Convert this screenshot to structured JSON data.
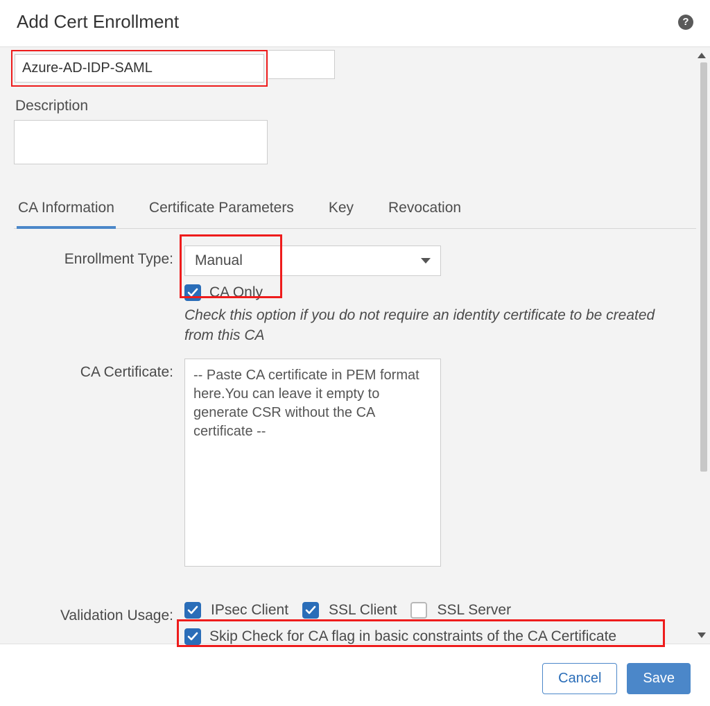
{
  "dialog": {
    "title": "Add Cert Enrollment",
    "help_tooltip": "?"
  },
  "form": {
    "name_value": "Azure-AD-IDP-SAML",
    "description_label": "Description",
    "description_value": ""
  },
  "tabs": [
    {
      "label": "CA Information",
      "active": true
    },
    {
      "label": "Certificate Parameters",
      "active": false
    },
    {
      "label": "Key",
      "active": false
    },
    {
      "label": "Revocation",
      "active": false
    }
  ],
  "ca_info": {
    "enrollment_type_label": "Enrollment Type:",
    "enrollment_type_value": "Manual",
    "ca_only_label": "CA Only",
    "ca_only_checked": true,
    "ca_only_helper": "Check this option if you do not require an identity certificate to be created from this CA",
    "ca_certificate_label": "CA Certificate:",
    "ca_certificate_placeholder": "-- Paste CA certificate in PEM format here.You can leave it empty to generate CSR without the CA certificate --",
    "validation_usage_label": "Validation Usage:",
    "usage": {
      "ipsec_client_label": "IPsec Client",
      "ipsec_client_checked": true,
      "ssl_client_label": "SSL Client",
      "ssl_client_checked": true,
      "ssl_server_label": "SSL Server",
      "ssl_server_checked": false
    },
    "skip_check_label": "Skip Check for CA flag in basic constraints of the CA Certificate",
    "skip_check_checked": true
  },
  "footer": {
    "cancel_label": "Cancel",
    "save_label": "Save"
  }
}
